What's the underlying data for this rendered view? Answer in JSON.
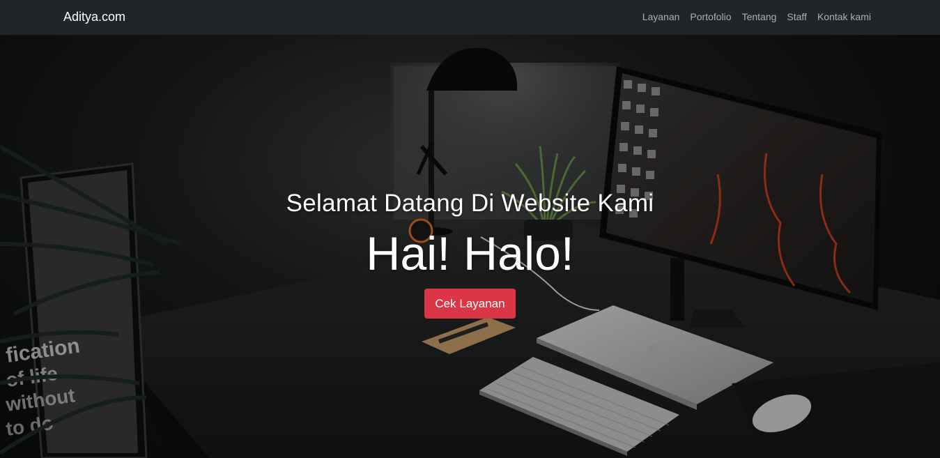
{
  "navbar": {
    "brand": "Aditya.com",
    "links": [
      "Layanan",
      "Portofolio",
      "Tentang",
      "Staff",
      "Kontak kami"
    ]
  },
  "hero": {
    "subtitle": "Selamat Datang Di Website Kami",
    "title": "Hai! Halo!",
    "cta_label": "Cek Layanan",
    "poster_text": "fication of life without to do"
  },
  "colors": {
    "navbar_bg": "#212529",
    "cta_bg": "#dc3545",
    "text": "#ffffff",
    "nav_link": "rgba(255,255,255,0.62)"
  }
}
